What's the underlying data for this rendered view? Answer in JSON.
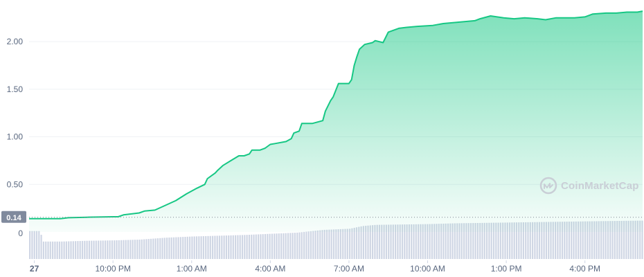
{
  "chart_data": {
    "type": "area",
    "y_ticks": [
      {
        "label": "2.00",
        "value": 2.0
      },
      {
        "label": "1.50",
        "value": 1.5
      },
      {
        "label": "1.00",
        "value": 1.0
      },
      {
        "label": "0.50",
        "value": 0.5
      }
    ],
    "ylim": [
      0,
      2.35
    ],
    "x_ticks": [
      {
        "label": "27",
        "bold": true,
        "hours": 0
      },
      {
        "label": "10:00 PM",
        "bold": false,
        "hours": 3
      },
      {
        "label": "1:00 AM",
        "bold": false,
        "hours": 6
      },
      {
        "label": "4:00 AM",
        "bold": false,
        "hours": 9
      },
      {
        "label": "7:00 AM",
        "bold": false,
        "hours": 12
      },
      {
        "label": "10:00 AM",
        "bold": false,
        "hours": 15
      },
      {
        "label": "1:00 PM",
        "bold": false,
        "hours": 18
      },
      {
        "label": "4:00 PM",
        "bold": false,
        "hours": 21
      }
    ],
    "x_range_hours": [
      -0.2,
      23.2
    ],
    "price_series": [
      [
        -0.2,
        0.14
      ],
      [
        1.0,
        0.14
      ],
      [
        1.3,
        0.15
      ],
      [
        2.0,
        0.155
      ],
      [
        3.0,
        0.16
      ],
      [
        3.2,
        0.16
      ],
      [
        3.4,
        0.18
      ],
      [
        4.0,
        0.2
      ],
      [
        4.2,
        0.22
      ],
      [
        4.6,
        0.23
      ],
      [
        5.0,
        0.28
      ],
      [
        5.4,
        0.33
      ],
      [
        5.8,
        0.4
      ],
      [
        6.2,
        0.46
      ],
      [
        6.5,
        0.5
      ],
      [
        6.6,
        0.56
      ],
      [
        6.9,
        0.62
      ],
      [
        7.0,
        0.65
      ],
      [
        7.2,
        0.7
      ],
      [
        7.5,
        0.75
      ],
      [
        7.8,
        0.8
      ],
      [
        8.0,
        0.8
      ],
      [
        8.2,
        0.82
      ],
      [
        8.3,
        0.86
      ],
      [
        8.6,
        0.86
      ],
      [
        8.8,
        0.88
      ],
      [
        9.0,
        0.92
      ],
      [
        9.2,
        0.93
      ],
      [
        9.6,
        0.95
      ],
      [
        9.8,
        0.98
      ],
      [
        9.9,
        1.04
      ],
      [
        10.1,
        1.06
      ],
      [
        10.2,
        1.14
      ],
      [
        10.6,
        1.14
      ],
      [
        11.0,
        1.17
      ],
      [
        11.1,
        1.27
      ],
      [
        11.3,
        1.38
      ],
      [
        11.4,
        1.42
      ],
      [
        11.6,
        1.56
      ],
      [
        12.0,
        1.56
      ],
      [
        12.1,
        1.6
      ],
      [
        12.2,
        1.75
      ],
      [
        12.3,
        1.84
      ],
      [
        12.4,
        1.92
      ],
      [
        12.6,
        1.97
      ],
      [
        12.9,
        1.99
      ],
      [
        13.0,
        2.01
      ],
      [
        13.3,
        1.99
      ],
      [
        13.5,
        2.1
      ],
      [
        13.9,
        2.14
      ],
      [
        14.2,
        2.15
      ],
      [
        14.6,
        2.16
      ],
      [
        15.2,
        2.17
      ],
      [
        15.6,
        2.19
      ],
      [
        16.0,
        2.2
      ],
      [
        16.8,
        2.22
      ],
      [
        17.0,
        2.24
      ],
      [
        17.4,
        2.27
      ],
      [
        17.9,
        2.25
      ],
      [
        18.3,
        2.24
      ],
      [
        18.7,
        2.25
      ],
      [
        19.2,
        2.24
      ],
      [
        19.5,
        2.23
      ],
      [
        19.9,
        2.25
      ],
      [
        20.2,
        2.25
      ],
      [
        20.6,
        2.25
      ],
      [
        21.0,
        2.26
      ],
      [
        21.3,
        2.29
      ],
      [
        21.8,
        2.3
      ],
      [
        22.2,
        2.3
      ],
      [
        22.6,
        2.31
      ],
      [
        23.0,
        2.31
      ],
      [
        23.2,
        2.32
      ]
    ],
    "volume_series": [
      [
        -0.2,
        0.28
      ],
      [
        0.2,
        0.28
      ],
      [
        0.3,
        0.55
      ],
      [
        1.0,
        0.55
      ],
      [
        2.0,
        0.53
      ],
      [
        3.0,
        0.52
      ],
      [
        4.0,
        0.5
      ],
      [
        5.0,
        0.45
      ],
      [
        6.0,
        0.42
      ],
      [
        7.0,
        0.4
      ],
      [
        8.0,
        0.38
      ],
      [
        9.0,
        0.35
      ],
      [
        10.0,
        0.32
      ],
      [
        11.0,
        0.25
      ],
      [
        12.0,
        0.22
      ],
      [
        12.5,
        0.15
      ],
      [
        13.0,
        0.12
      ],
      [
        14.0,
        0.11
      ],
      [
        15.0,
        0.1
      ],
      [
        16.0,
        0.08
      ],
      [
        17.0,
        0.07
      ],
      [
        18.0,
        0.06
      ],
      [
        19.0,
        0.05
      ],
      [
        20.0,
        0.04
      ],
      [
        21.0,
        0.03
      ],
      [
        22.0,
        0.02
      ],
      [
        23.2,
        0.01
      ]
    ],
    "zero_label": "0",
    "current_price_label": "0.14",
    "current_price_value": 0.14,
    "colors": {
      "line": "#16c784",
      "fill_top": "#16c784",
      "grid": "#eff2f5",
      "volume_bar": "#cfd6e4",
      "badge": "#808a9d"
    },
    "grid": true
  },
  "watermark": {
    "text": "CoinMarketCap",
    "icon": "coinmarketcap-logo-icon"
  }
}
